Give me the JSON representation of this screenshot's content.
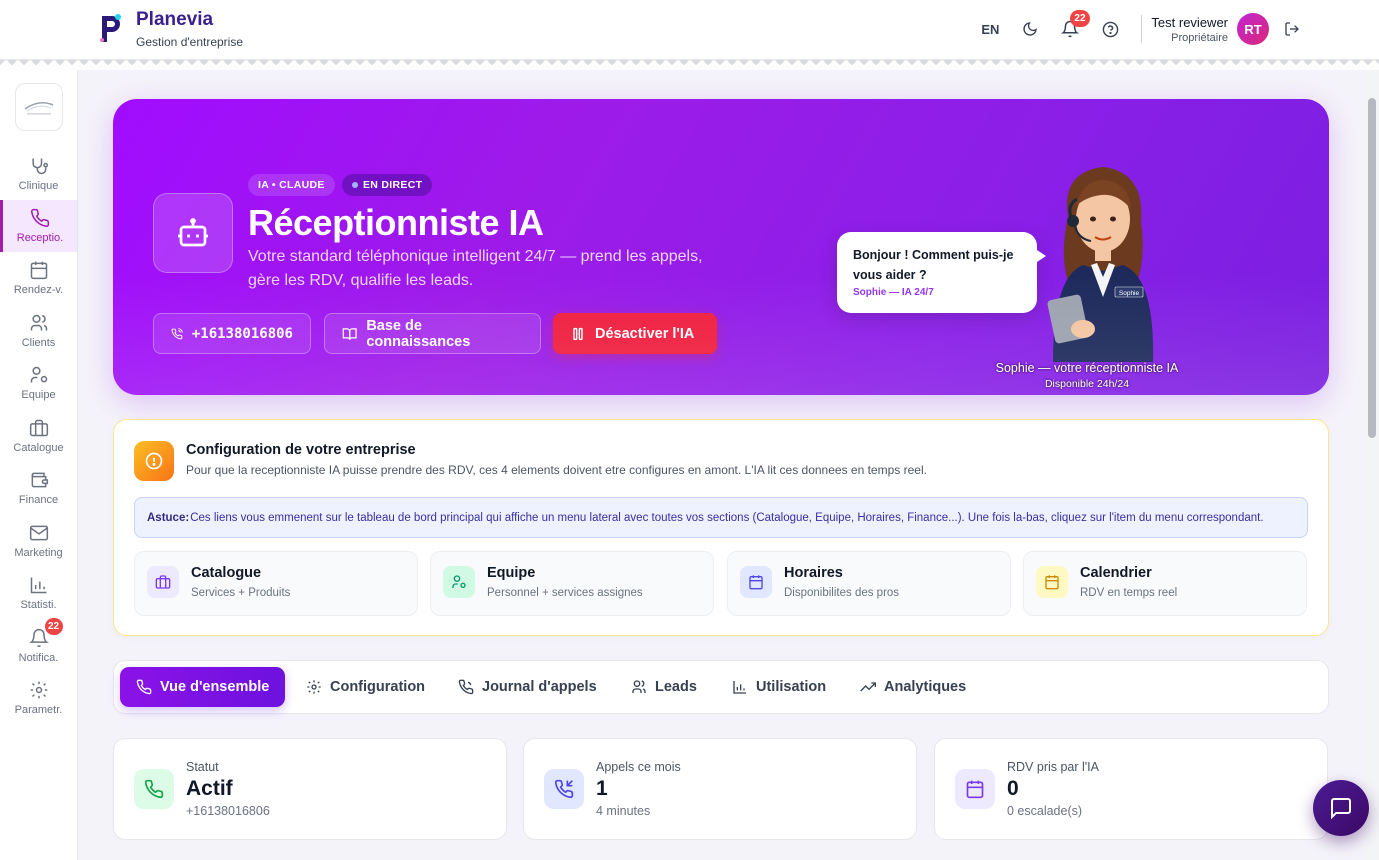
{
  "header": {
    "app_name": "Planevia",
    "app_subtitle": "Gestion d'entreprise",
    "language": "EN",
    "notifications_count": "22",
    "user_name": "Test reviewer",
    "user_role": "Propriétaire",
    "user_initials": "RT"
  },
  "sidebar": {
    "items": [
      {
        "label": "Clinique",
        "icon": "stethoscope-icon"
      },
      {
        "label": "Receptio.",
        "icon": "phone-icon",
        "active": true
      },
      {
        "label": "Rendez-v.",
        "icon": "calendar-icon"
      },
      {
        "label": "Clients",
        "icon": "users-icon"
      },
      {
        "label": "Equipe",
        "icon": "user-cog-icon"
      },
      {
        "label": "Catalogue",
        "icon": "briefcase-icon"
      },
      {
        "label": "Finance",
        "icon": "wallet-icon"
      },
      {
        "label": "Marketing",
        "icon": "mail-icon"
      },
      {
        "label": "Statisti.",
        "icon": "bar-chart-icon"
      },
      {
        "label": "Notifica.",
        "icon": "bell-icon",
        "badge": "22"
      },
      {
        "label": "Parametr.",
        "icon": "settings-icon"
      }
    ]
  },
  "hero": {
    "chip_ai": "IA • CLAUDE",
    "chip_live": "EN DIRECT",
    "title": "Réceptionniste IA",
    "description": "Votre standard téléphonique intelligent 24/7 — prend les appels, gère les RDV, qualifie les leads.",
    "phone_button": "+16138016806",
    "kb_button": "Base de connaissances",
    "deactivate_button": "Désactiver l'IA",
    "bubble_text": "Bonjour ! Comment puis-je vous aider ?",
    "bubble_sub": "Sophie — IA 24/7",
    "badge_name": "Sophie",
    "caption": "Sophie — votre réceptionniste IA",
    "caption_sub": "Disponible 24h/24"
  },
  "config": {
    "title": "Configuration de votre entreprise",
    "description": "Pour que la receptionniste IA puisse prendre des RDV, ces 4 elements doivent etre configures en amont. L'IA lit ces donnees en temps reel.",
    "tip_label": "Astuce:",
    "tip_text": "Ces liens vous emmenent sur le tableau de bord principal qui affiche un menu lateral avec toutes vos sections (Catalogue, Equipe, Horaires, Finance...). Une fois la-bas, cliquez sur l'item du menu correspondant.",
    "items": [
      {
        "title": "Catalogue",
        "sub": "Services + Produits",
        "icon": "briefcase-icon",
        "color": "#7c3aed"
      },
      {
        "title": "Equipe",
        "sub": "Personnel + services assignes",
        "icon": "user-cog-icon",
        "color": "#059669"
      },
      {
        "title": "Horaires",
        "sub": "Disponibilites des pros",
        "icon": "calendar-icon",
        "color": "#4f46e5"
      },
      {
        "title": "Calendrier",
        "sub": "RDV en temps reel",
        "icon": "calendar-icon",
        "color": "#ca8a04"
      }
    ]
  },
  "tabs": [
    {
      "label": "Vue d'ensemble",
      "icon": "phone-icon",
      "active": true
    },
    {
      "label": "Configuration",
      "icon": "gear-icon"
    },
    {
      "label": "Journal d'appels",
      "icon": "phone-call-icon"
    },
    {
      "label": "Leads",
      "icon": "users-icon"
    },
    {
      "label": "Utilisation",
      "icon": "bar-chart-icon"
    },
    {
      "label": "Analytiques",
      "icon": "trending-up-icon"
    }
  ],
  "stats": [
    {
      "label": "Statut",
      "value": "Actif",
      "sub": "+16138016806",
      "icon": "phone-icon",
      "color": "#16a34a"
    },
    {
      "label": "Appels ce mois",
      "value": "1",
      "sub": "4 minutes",
      "icon": "phone-incoming-icon",
      "color": "#4f46e5"
    },
    {
      "label": "RDV pris par l'IA",
      "value": "0",
      "sub": "0 escalade(s)",
      "icon": "calendar-icon",
      "color": "#7c3aed"
    }
  ]
}
